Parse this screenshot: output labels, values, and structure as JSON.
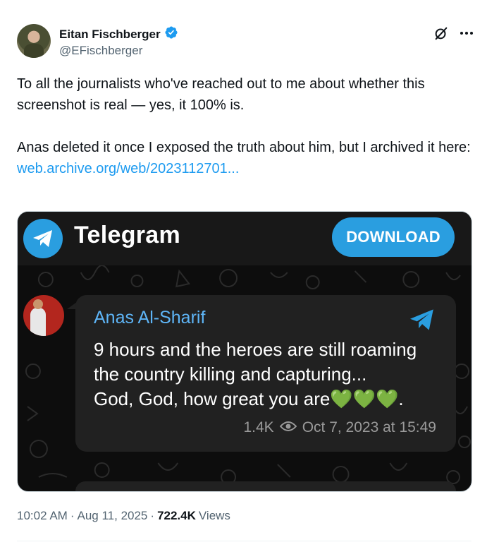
{
  "author": {
    "name": "Eitan Fischberger",
    "handle": "@EFischberger",
    "verified": true
  },
  "tweet": {
    "line1": "To all the journalists who've reached out to me about whether this screenshot is real — yes, it 100% is.",
    "line2": "Anas deleted it once I exposed the truth about him, but I archived it here:",
    "link": "web.archive.org/web/2023112701..."
  },
  "media": {
    "app_name": "Telegram",
    "download_label": "DOWNLOAD",
    "channel_name": "Anas Al-Sharif",
    "message_line1": "9 hours and the heroes are still roaming",
    "message_line2": "the country killing and capturing...",
    "message_line3": "God, God, how great you are💚💚💚.",
    "views": "1.4K",
    "timestamp": "Oct 7, 2023 at 15:49"
  },
  "footer": {
    "time": "10:02 AM",
    "sep1": "·",
    "date": "Aug 11, 2025",
    "sep2": "·",
    "views_count": "722.4K",
    "views_label": "Views"
  },
  "colors": {
    "link": "#1d9bf0",
    "telegram_blue": "#2a9ee0",
    "channel_name": "#5eb5f7",
    "verified": "#1d9bf0"
  },
  "icons": [
    "verified-badge-icon",
    "grok-icon",
    "more-icon",
    "telegram-logo-icon",
    "telegram-plane-icon",
    "eye-icon"
  ]
}
